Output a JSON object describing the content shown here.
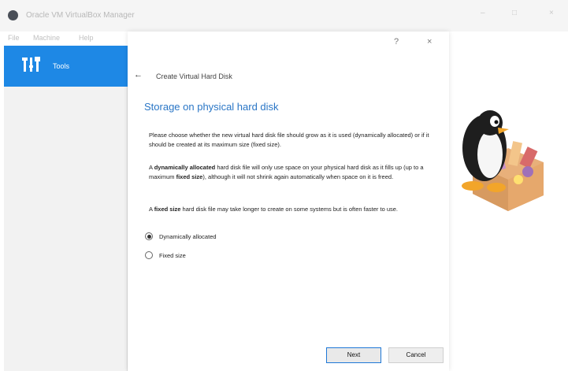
{
  "window": {
    "title": "Oracle VM VirtualBox Manager",
    "minimize": "–",
    "maximize": "□",
    "close": "×"
  },
  "menubar": {
    "items": [
      "File",
      "Machine",
      "Help"
    ]
  },
  "sidebar": {
    "tools_label": "Tools"
  },
  "dialog": {
    "help_button": "?",
    "close_button": "×",
    "back_arrow": "←",
    "wizard_title": "Create Virtual Hard Disk",
    "heading": "Storage on physical hard disk",
    "para1": "Please choose whether the new virtual hard disk file should grow as it is used (dynamically allocated) or if it should be created at its maximum size (fixed size).",
    "para2_prefix": "A ",
    "para2_bold1": "dynamically allocated",
    "para2_mid": " hard disk file will only use space on your physical hard disk as it fills up (up to a maximum ",
    "para2_bold2": "fixed size",
    "para2_suffix": "), although it will not shrink again automatically when space on it is freed.",
    "para3_prefix": "A ",
    "para3_bold": "fixed size",
    "para3_suffix": " hard disk file may take longer to create on some systems but is often faster to use.",
    "options": [
      {
        "label": "Dynamically allocated",
        "selected": true
      },
      {
        "label": "Fixed size",
        "selected": false
      }
    ],
    "next_label": "Next",
    "cancel_label": "Cancel"
  },
  "colors": {
    "accent": "#1e88e5",
    "heading": "#2a76c6"
  }
}
